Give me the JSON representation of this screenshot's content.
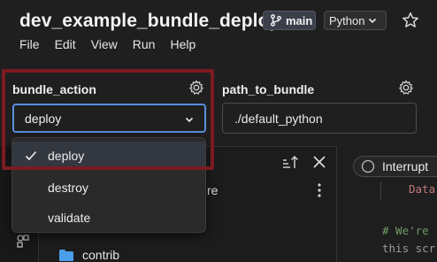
{
  "header": {
    "title": "dev_example_bundle_deploy",
    "branch": "main",
    "language": "Python"
  },
  "menu": [
    "File",
    "Edit",
    "View",
    "Run",
    "Help"
  ],
  "widgets": {
    "bundle_action": {
      "label": "bundle_action",
      "selected": "deploy",
      "options": [
        "deploy",
        "destroy",
        "validate"
      ]
    },
    "path_to_bundle": {
      "label": "path_to_bundle",
      "value": "./default_python"
    }
  },
  "file_panel": {
    "fragment": "re",
    "folder": "contrib"
  },
  "code_panel": {
    "interrupt_label": "Interrupt",
    "line1": "Data",
    "comment1": "# We're",
    "comment2": "this scr"
  },
  "colors": {
    "accent": "#5b8fe0",
    "highlight": "#7c1a22",
    "folder": "#4a9ee8"
  }
}
